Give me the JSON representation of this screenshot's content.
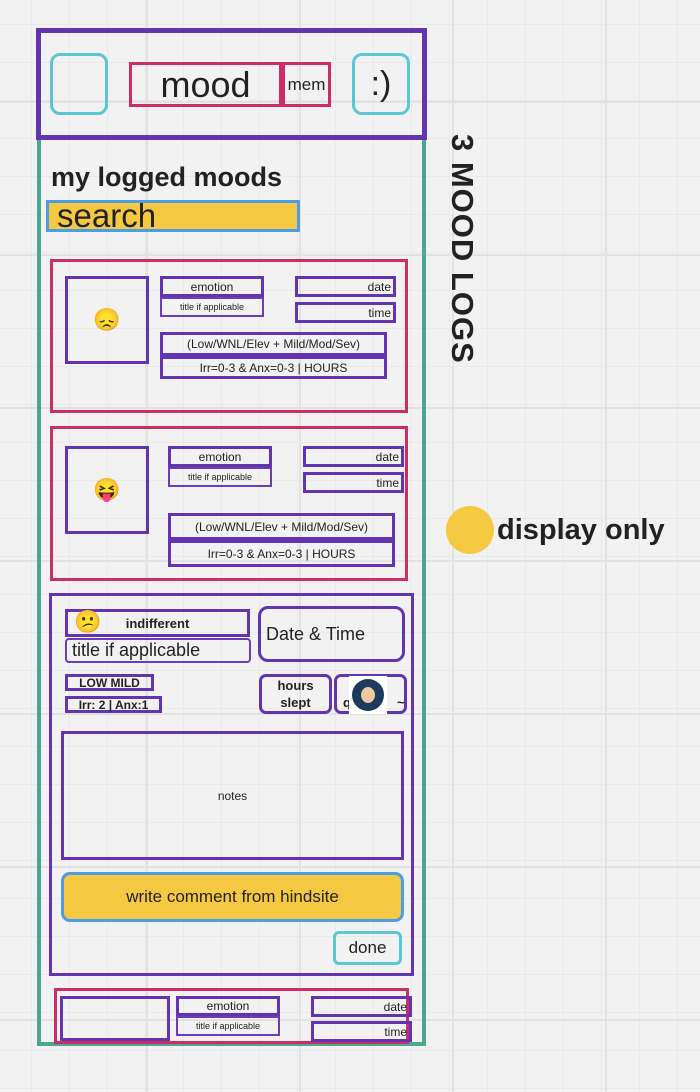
{
  "header": {
    "title": "mood",
    "mem_label": "mem",
    "smiley_button": ":)"
  },
  "page": {
    "heading": "my logged moods",
    "search_label": "search"
  },
  "annotations": {
    "mood_logs": "3 MOOD LOGS",
    "display_only": "display only"
  },
  "logs": [
    {
      "emoji": "😞",
      "emotion": "emotion",
      "title": "title if applicable",
      "date": "date",
      "time": "time",
      "scale": "(Low/WNL/Elev + Mild/Mod/Sev)",
      "ratings": "Irr=0-3 & Anx=0-3 | HOURS"
    },
    {
      "emoji": "😝",
      "emotion": "emotion",
      "title": "title if applicable",
      "date": "date",
      "time": "time",
      "scale": "(Low/WNL/Elev + Mild/Mod/Sev)",
      "ratings": "Irr=0-3 & Anx=0-3 | HOURS"
    }
  ],
  "expanded": {
    "emoji": "😕",
    "emotion": "indifferent",
    "title": "title if applicable",
    "datetime": "Date & Time",
    "level": "LOW MILD",
    "ratings": "Irr: 2 | Anx:1",
    "hours": "hours slept",
    "quality_prefix": "q",
    "quality_suffix": "~",
    "notes": "notes",
    "comment_button": "write comment from hindsite",
    "done_button": "done"
  },
  "partial_log": {
    "emotion": "emotion",
    "title": "title if applicable",
    "date": "date",
    "time": "time"
  },
  "colors": {
    "purple": "#6234b0",
    "pink": "#cc2d66",
    "teal": "#5bc7d3",
    "green": "#4aa890",
    "yellow": "#f5c842",
    "blue": "#4a9ee8"
  }
}
